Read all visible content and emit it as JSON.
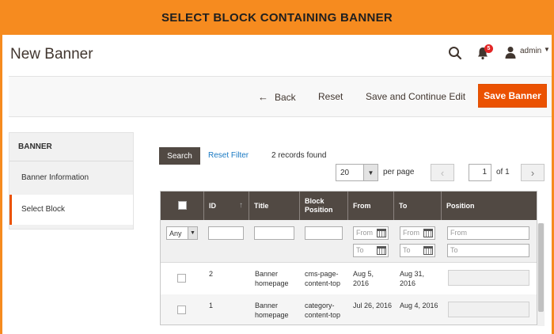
{
  "banner": {
    "title": "SELECT BLOCK CONTAINING BANNER"
  },
  "header": {
    "title": "New Banner",
    "notifications_count": "5",
    "user_name": "admin"
  },
  "actions": {
    "back": "Back",
    "reset": "Reset",
    "save_continue": "Save and Continue Edit",
    "save": "Save Banner"
  },
  "sidebar": {
    "title": "BANNER",
    "items": [
      {
        "label": "Banner Information"
      },
      {
        "label": "Select Block"
      }
    ]
  },
  "grid_toolbar": {
    "search": "Search",
    "reset_filter": "Reset Filter",
    "records_found": "2 records found",
    "per_page_value": "20",
    "per_page_label": "per page",
    "page": "1",
    "of_pages": "of 1"
  },
  "grid": {
    "columns": [
      "ID",
      "Title",
      "Block Position",
      "From",
      "To",
      "Position"
    ],
    "filters": {
      "any": "Any",
      "from": "From",
      "to": "To"
    },
    "rows": [
      {
        "id": "2",
        "title": "Banner homepage",
        "block_position": "cms-page-content-top",
        "from": "Aug 5, 2016",
        "to": "Aug 31, 2016"
      },
      {
        "id": "1",
        "title": "Banner homepage",
        "block_position": "category-content-top",
        "from": "Jul 26, 2016",
        "to": "Aug 4, 2016"
      }
    ]
  },
  "colors": {
    "accent": "#f68b1f",
    "primary_button": "#eb5202",
    "grid_header": "#514943",
    "link": "#1979c3"
  }
}
